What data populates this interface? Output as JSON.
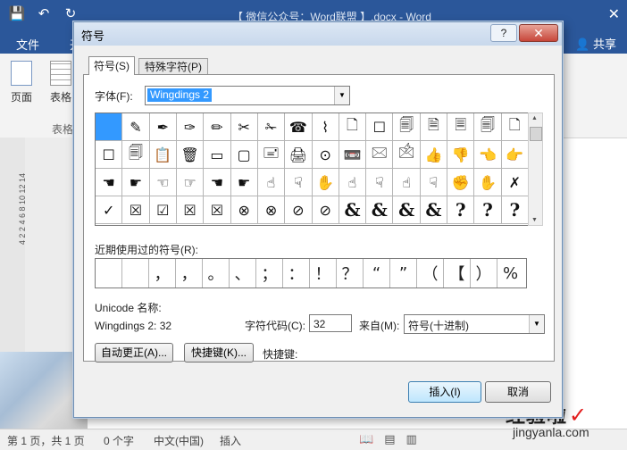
{
  "word": {
    "qat": [
      "💾",
      "↶",
      "↻"
    ],
    "doc_title": "【 微信公众号：Word联盟 】.docx - Word",
    "close": "✕",
    "tab_file": "文件",
    "tab_partial": "开",
    "share": "共享",
    "ribbon": {
      "page_label": "页面",
      "table_label": "表格",
      "group_label": "表格"
    },
    "ruler_marks": "4  2  2  4  6  8  10  12  14",
    "status": {
      "pages": "第 1 页，共 1 页",
      "words": "0 个字",
      "lang": "中文(中国)",
      "mode": "插入"
    },
    "watermark": {
      "main": "经验啦",
      "check": "✓",
      "sub": "jingyanla.com"
    }
  },
  "dialog": {
    "title": "符号",
    "help": "?",
    "close": "✕",
    "tabs": {
      "symbol": "符号(S)",
      "special": "特殊字符(P)"
    },
    "font_label": "字体(F):",
    "font_value": "Wingdings 2",
    "symbols": [
      [
        "",
        "✎",
        "✒",
        "✑",
        "✏",
        "✂",
        "✁",
        "☎",
        "⌇",
        "🗋",
        "☐",
        "🗐",
        "🗎",
        "🗏",
        "🗐",
        "🗋"
      ],
      [
        "☐",
        "🗐",
        "📋",
        "🗑",
        "▭",
        "▢",
        "🖃",
        "🖨",
        "⊙",
        "📼",
        "🖂",
        "🖄",
        "👍",
        "👎",
        "👈",
        "👉"
      ],
      [
        "☚",
        "☛",
        "☜",
        "☞",
        "☚",
        "☛",
        "☝",
        "☟",
        "✋",
        "☝",
        "☟",
        "☝",
        "☟",
        "✊",
        "✋",
        "✗"
      ],
      [
        "✓",
        "☒",
        "☑",
        "☒",
        "☒",
        "⊗",
        "⊗",
        "⊘",
        "⊘",
        "&",
        "&",
        "&",
        "&",
        "?",
        "?",
        "?"
      ]
    ],
    "recent_label": "近期使用过的符号(R):",
    "recent": [
      "",
      "",
      "，",
      "，",
      "。",
      "、",
      "；",
      "：",
      "！",
      "？",
      "“",
      "”",
      "（",
      "【",
      "）",
      "%"
    ],
    "unicode_label": "Unicode 名称:",
    "unicode_value": "Wingdings 2: 32",
    "code_label": "字符代码(C):",
    "code_value": "32",
    "from_label": "来自(M):",
    "from_value": "符号(十进制)",
    "btn_autocorrect": "自动更正(A)...",
    "btn_shortcut": "快捷键(K)...",
    "shortcut_label": "快捷键:",
    "btn_insert": "插入(I)",
    "btn_cancel": "取消"
  }
}
